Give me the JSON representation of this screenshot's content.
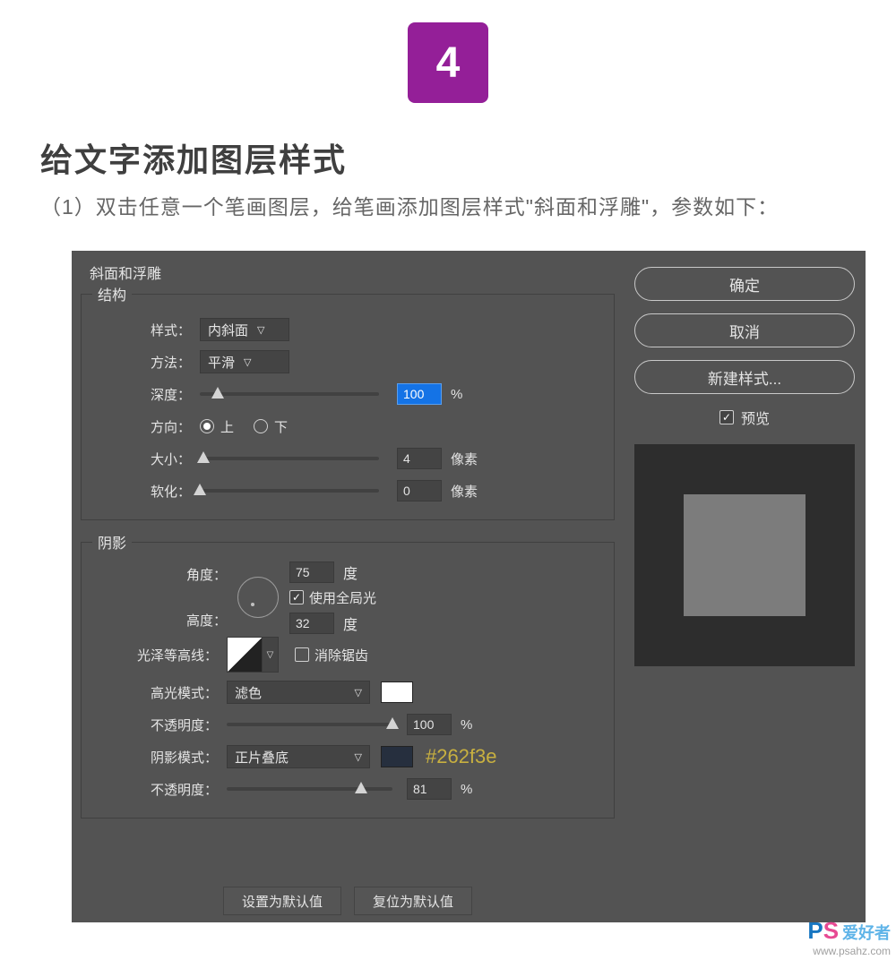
{
  "step_number": "4",
  "title": "给文字添加图层样式",
  "subtitle": "（1）双击任意一个笔画图层，给笔画添加图层样式\"斜面和浮雕\"，参数如下：",
  "panel": {
    "name": "斜面和浮雕",
    "structure": {
      "legend": "结构",
      "style_label": "样式：",
      "style_value": "内斜面",
      "technique_label": "方法：",
      "technique_value": "平滑",
      "depth_label": "深度：",
      "depth_value": "100",
      "depth_unit": "%",
      "direction_label": "方向：",
      "direction_up": "上",
      "direction_down": "下",
      "size_label": "大小：",
      "size_value": "4",
      "size_unit": "像素",
      "soften_label": "软化：",
      "soften_value": "0",
      "soften_unit": "像素"
    },
    "shading": {
      "legend": "阴影",
      "angle_label": "角度：",
      "angle_value": "75",
      "angle_unit": "度",
      "global_light_label": "使用全局光",
      "altitude_label": "高度：",
      "altitude_value": "32",
      "altitude_unit": "度",
      "contour_label": "光泽等高线：",
      "antialias_label": "消除锯齿",
      "highlight_mode_label": "高光模式：",
      "highlight_mode_value": "滤色",
      "highlight_color": "#ffffff",
      "highlight_opacity_label": "不透明度：",
      "highlight_opacity_value": "100",
      "highlight_opacity_unit": "%",
      "shadow_mode_label": "阴影模式：",
      "shadow_mode_value": "正片叠底",
      "shadow_color": "#262f3e",
      "shadow_color_annot": "#262f3e",
      "shadow_opacity_label": "不透明度：",
      "shadow_opacity_value": "81",
      "shadow_opacity_unit": "%"
    },
    "buttons": {
      "default": "设置为默认值",
      "reset": "复位为默认值"
    }
  },
  "side": {
    "ok": "确定",
    "cancel": "取消",
    "new_style": "新建样式...",
    "preview": "预览"
  },
  "watermark": {
    "p": "P",
    "s": "S",
    "cn": "爱好者",
    "url": "www.psahz.com"
  }
}
